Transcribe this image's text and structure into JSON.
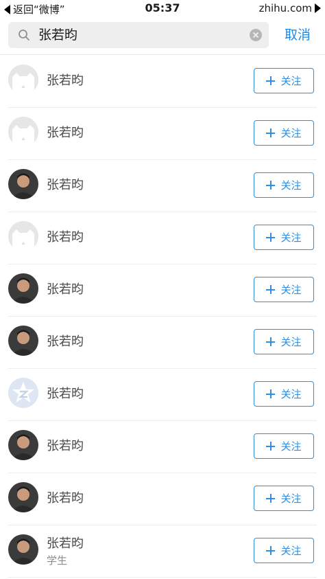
{
  "status_bar": {
    "back_label": "返回“微博”",
    "time": "05:37",
    "site": "zhihu.com"
  },
  "search": {
    "query": "张若昀",
    "cancel_label": "取消"
  },
  "results": [
    {
      "name": "张若昀",
      "subtitle": "",
      "avatar": "default-avatar",
      "follow_label": "关注"
    },
    {
      "name": "张若昀",
      "subtitle": "",
      "avatar": "default-avatar",
      "follow_label": "关注"
    },
    {
      "name": "张若昀",
      "subtitle": "",
      "avatar": "photo-avatar",
      "follow_label": "关注"
    },
    {
      "name": "张若昀",
      "subtitle": "",
      "avatar": "default-avatar",
      "follow_label": "关注"
    },
    {
      "name": "张若昀",
      "subtitle": "",
      "avatar": "photo-avatar",
      "follow_label": "关注"
    },
    {
      "name": "张若昀",
      "subtitle": "",
      "avatar": "photo-avatar",
      "follow_label": "关注"
    },
    {
      "name": "张若昀",
      "subtitle": "",
      "avatar": "qq-star-avatar",
      "follow_label": "关注"
    },
    {
      "name": "张若昀",
      "subtitle": "",
      "avatar": "photo-avatar",
      "follow_label": "关注"
    },
    {
      "name": "张若昀",
      "subtitle": "",
      "avatar": "photo-avatar",
      "follow_label": "关注"
    },
    {
      "name": "张若昀",
      "subtitle": "学生",
      "avatar": "photo-avatar",
      "follow_label": "关注"
    }
  ],
  "colors": {
    "accent": "#2e8fe0",
    "search_bg": "#eeeeef",
    "divider": "#ececec"
  }
}
